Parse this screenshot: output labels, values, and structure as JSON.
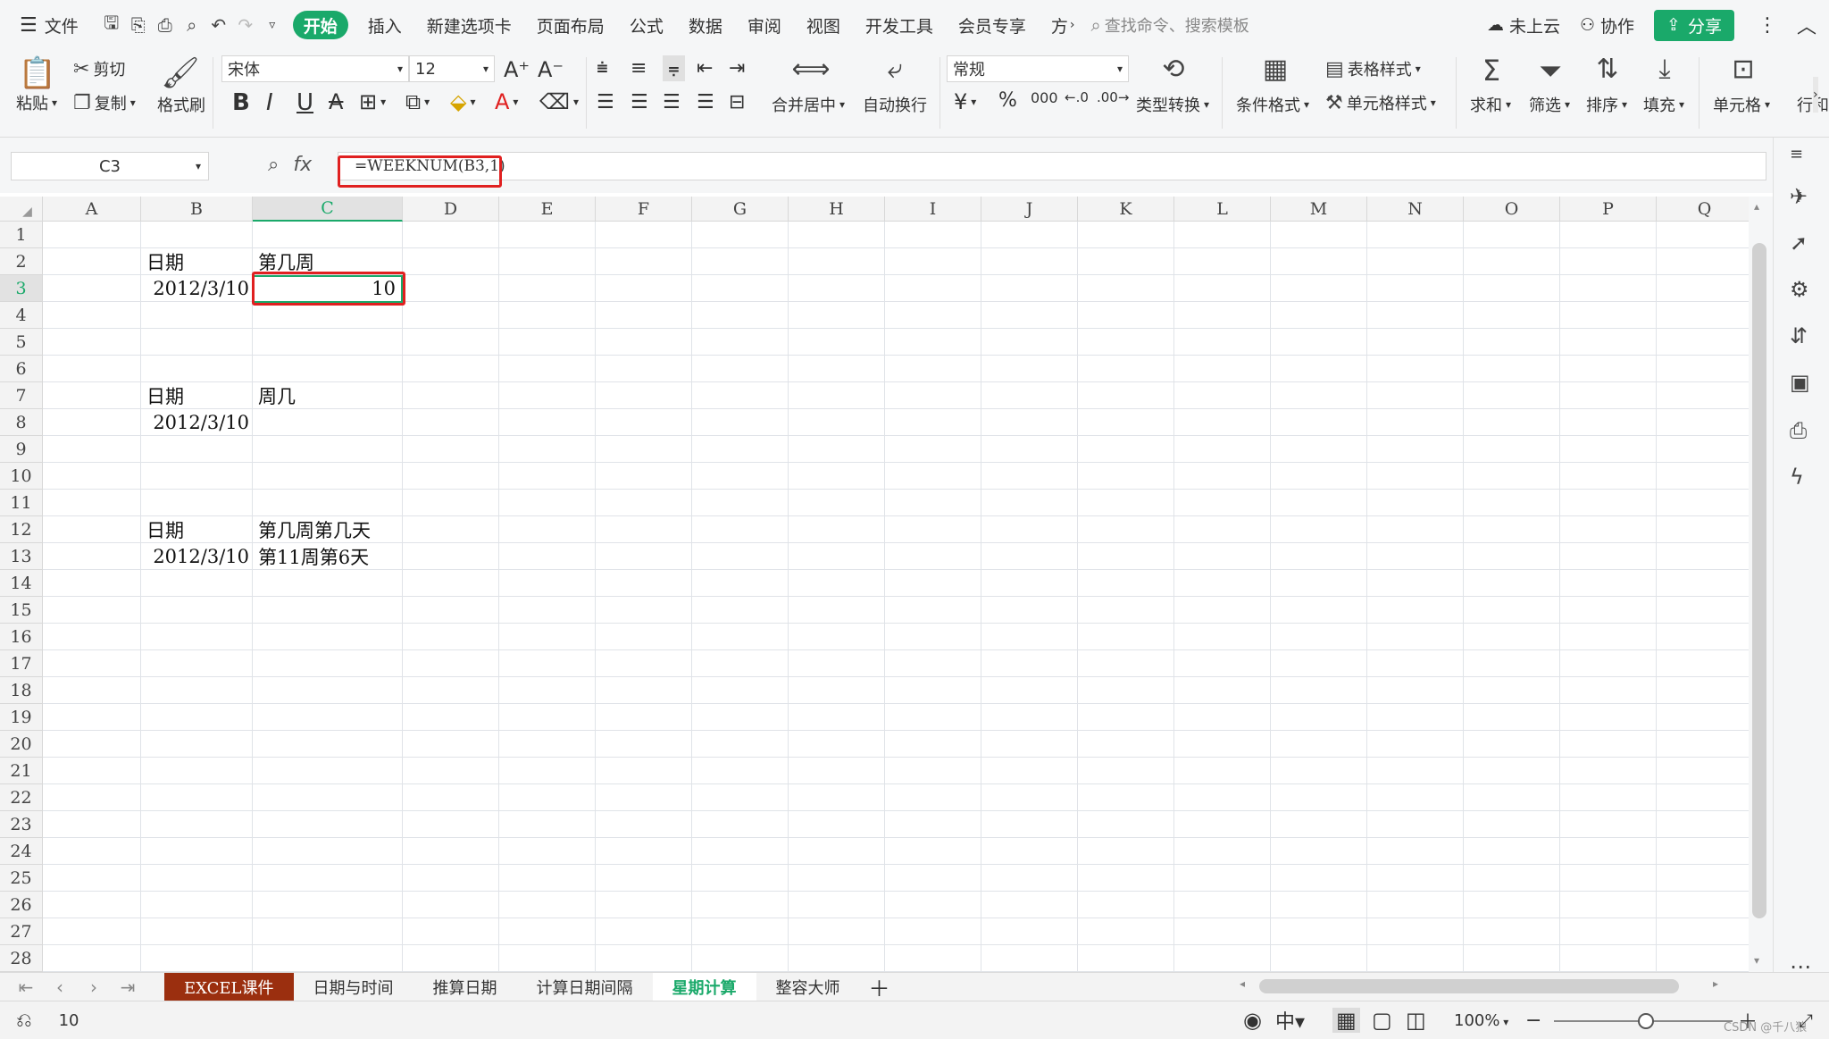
{
  "menubar": {
    "file_label": "文件",
    "tabs": [
      {
        "label": "开始",
        "active": true
      },
      {
        "label": "插入"
      },
      {
        "label": "新建选项卡"
      },
      {
        "label": "页面布局"
      },
      {
        "label": "公式"
      },
      {
        "label": "数据"
      },
      {
        "label": "审阅"
      },
      {
        "label": "视图"
      },
      {
        "label": "开发工具"
      },
      {
        "label": "会员专享"
      },
      {
        "label": "方"
      }
    ],
    "search_placeholder": "查找命令、搜索模板",
    "cloud_label": "未上云",
    "collab_label": "协作",
    "share_label": "分享"
  },
  "ribbon": {
    "paste": "粘贴",
    "cut": "剪切",
    "copy": "复制",
    "format_painter": "格式刷",
    "font_name": "宋体",
    "font_size": "12",
    "merge_center": "合并居中",
    "wrap_text": "自动换行",
    "number_format": "常规",
    "type_convert": "类型转换",
    "conditional_format": "条件格式",
    "table_style": "表格样式",
    "cell_style": "单元格样式",
    "sum": "求和",
    "filter": "筛选",
    "sort": "排序",
    "fill": "填充",
    "cell": "单元格",
    "row_col": "行和"
  },
  "formula_bar": {
    "name_box": "C3",
    "fx_label": "fx",
    "formula": "=WEEKNUM(B3,1)"
  },
  "grid": {
    "columns": [
      "A",
      "B",
      "C",
      "D",
      "E",
      "F",
      "G",
      "H",
      "I",
      "J",
      "K",
      "L",
      "M",
      "N",
      "O",
      "P",
      "Q"
    ],
    "selected_column": "C",
    "selected_row": "3",
    "rows": [
      "1",
      "2",
      "3",
      "4",
      "5",
      "6",
      "7",
      "8",
      "9",
      "10",
      "11",
      "12",
      "13",
      "14",
      "15",
      "16",
      "17",
      "18",
      "19",
      "20",
      "21",
      "22",
      "23",
      "24",
      "25",
      "26",
      "27",
      "28"
    ],
    "cells": {
      "B2": "日期",
      "C2": "第几周",
      "B3": "2012/3/10",
      "C3": "10",
      "B7": "日期",
      "C7": "周几",
      "B8": "2012/3/10",
      "B12": "日期",
      "C12": "第几周第几天",
      "B13": "2012/3/10",
      "C13": "第11周第6天"
    }
  },
  "sheet_tabs": [
    {
      "label": "EXCEL课件",
      "style": "red"
    },
    {
      "label": "日期与时间"
    },
    {
      "label": "推算日期"
    },
    {
      "label": "计算日期间隔"
    },
    {
      "label": "星期计算",
      "active": true
    },
    {
      "label": "整容大师"
    }
  ],
  "status": {
    "value": "10",
    "zoom": "100%",
    "watermark": "CSDN @千八狼"
  },
  "colors": {
    "accent": "#1aa96a",
    "highlight": "#e02020",
    "tab_red": "#9b2f0f"
  }
}
